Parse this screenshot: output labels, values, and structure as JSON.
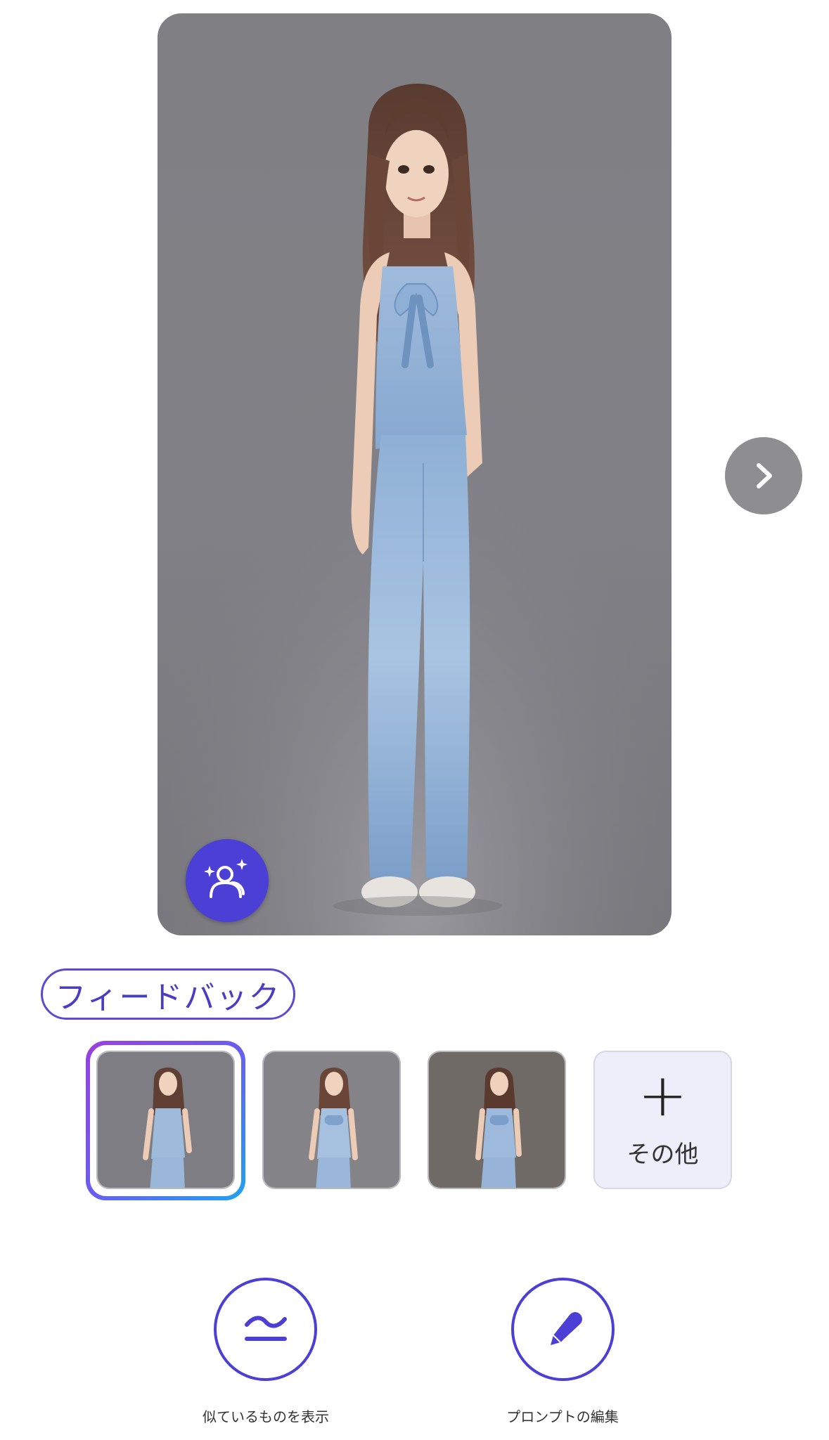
{
  "main_image": {
    "subject": "figure"
  },
  "feedback": {
    "label": "フィードバック"
  },
  "thumbnails": [
    {
      "selected": true
    },
    {
      "selected": false
    },
    {
      "selected": false
    }
  ],
  "more": {
    "plus": "+",
    "label": "その他"
  },
  "actions": {
    "similar_label": "似ているものを表示",
    "edit_label": "プロンプトの編集"
  },
  "colors": {
    "accent": "#4b3fd6",
    "badge": "#4b3fd6",
    "next_button": "#8e8e90",
    "card_bg": "#808086"
  },
  "icons": {
    "badge": "sparkle-person-icon",
    "next": "chevron-right-icon",
    "similar": "approx-equal-icon",
    "edit": "pen-icon"
  }
}
